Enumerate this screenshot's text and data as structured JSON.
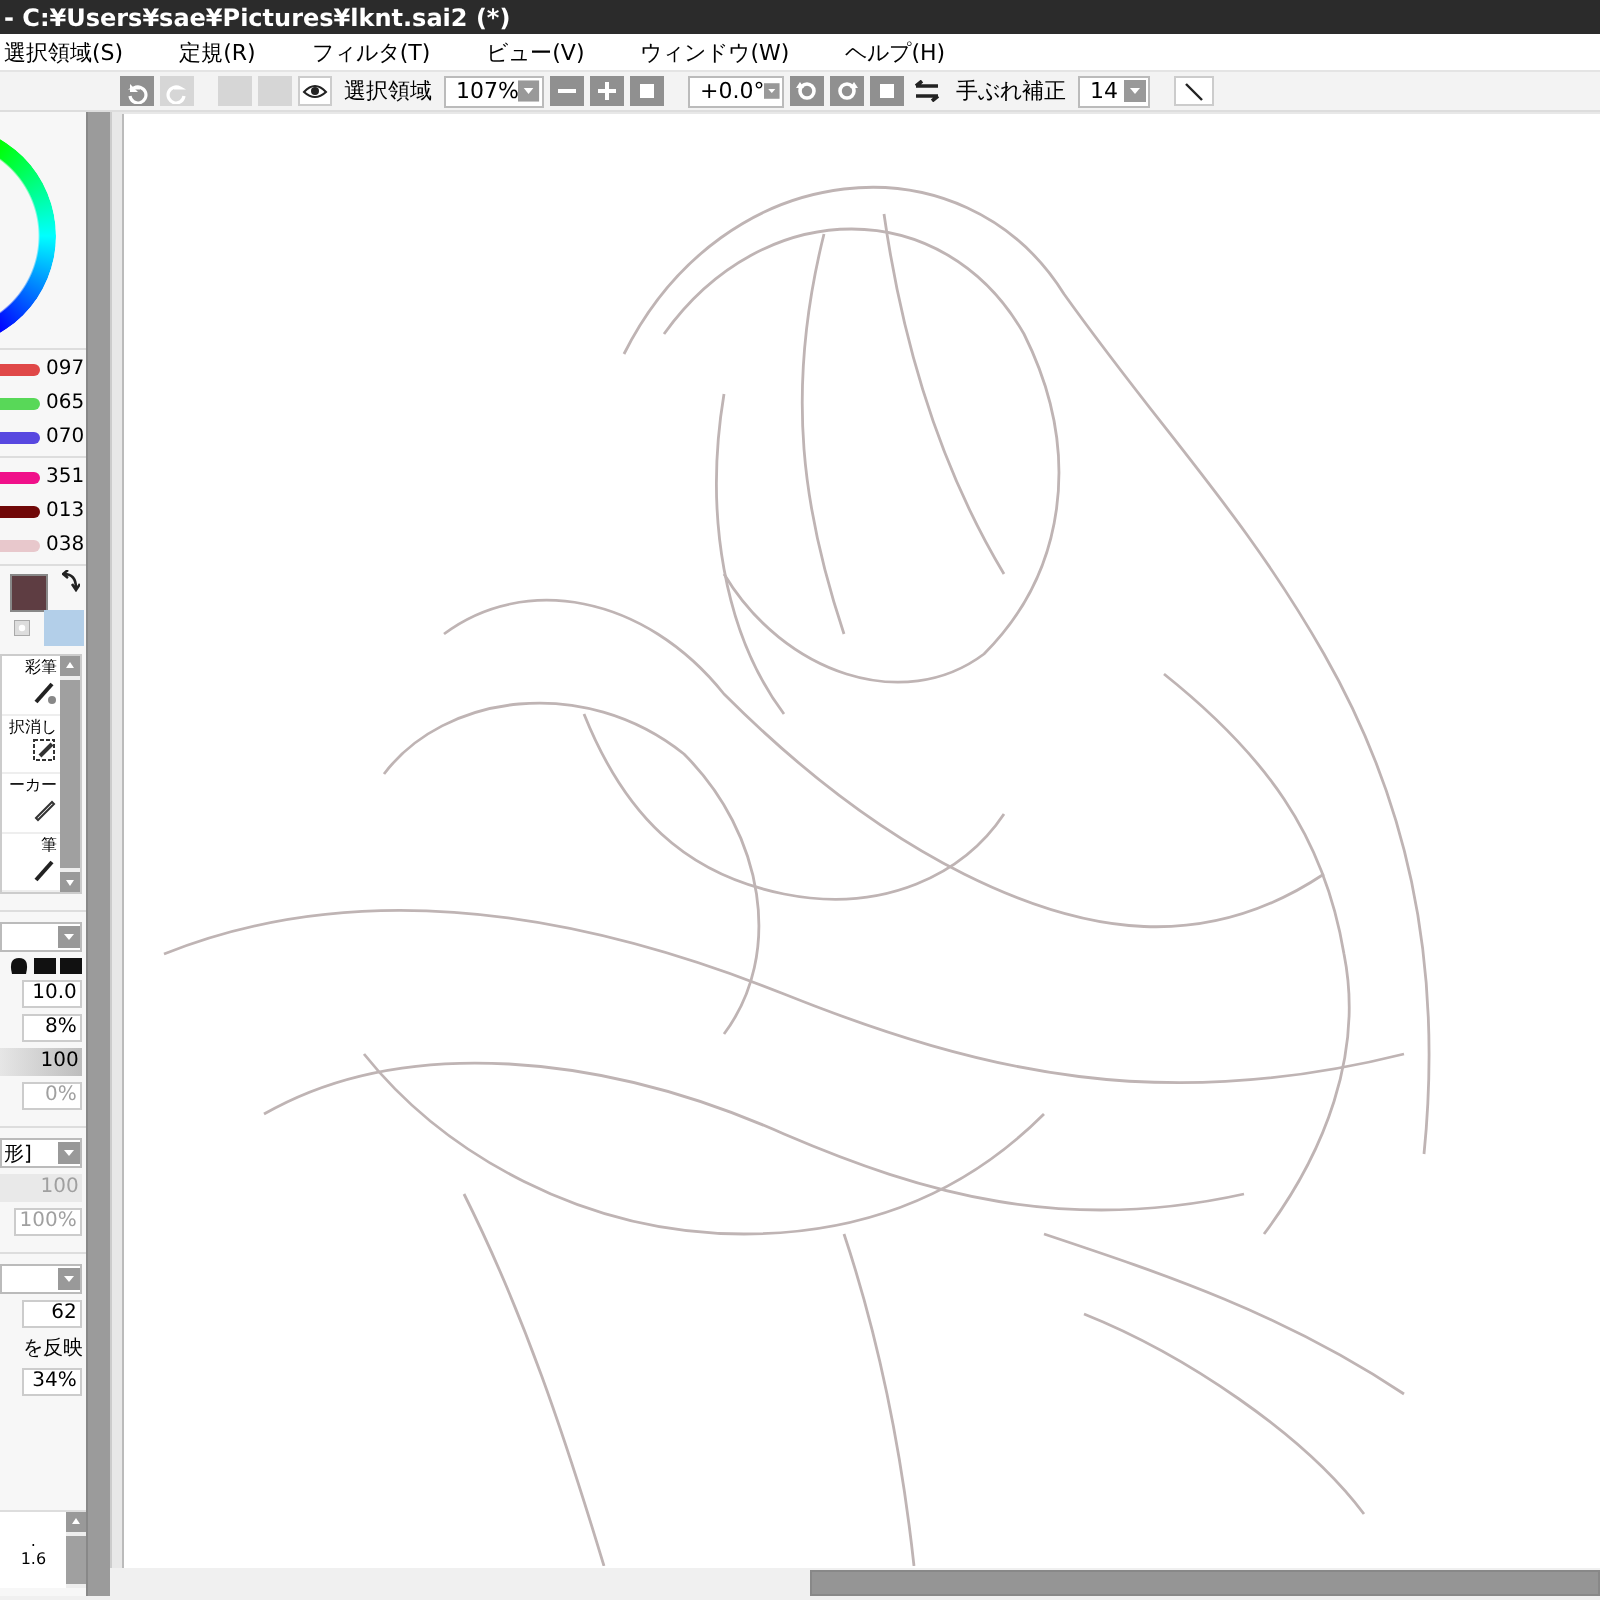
{
  "window": {
    "title": "- C:¥Users¥sae¥Pictures¥lknt.sai2 (*)"
  },
  "menu": [
    {
      "label": "選択領域(S)"
    },
    {
      "label": "定規(R)"
    },
    {
      "label": "フィルタ(T)"
    },
    {
      "label": "ビュー(V)"
    },
    {
      "label": "ウィンドウ(W)"
    },
    {
      "label": "ヘルプ(H)"
    }
  ],
  "toolbar": {
    "history": [
      {
        "kind": "undo",
        "disabled": false
      },
      {
        "kind": "redo",
        "disabled": true
      },
      {
        "kind": "blank",
        "disabled": true
      },
      {
        "kind": "blank",
        "disabled": true
      }
    ],
    "selection_label": "選択領域",
    "zoom": "107%",
    "angle": "+0.0°",
    "stabilizer_label": "手ぶれ補正",
    "stabilizer": "14"
  },
  "color_sliders": [
    [
      {
        "value": "097",
        "color": "#e04848"
      },
      {
        "value": "065",
        "color": "#58d858"
      },
      {
        "value": "070",
        "color": "#5848e0"
      }
    ],
    [
      {
        "value": "351",
        "color": "#f0108a"
      },
      {
        "value": "013",
        "color": "#700808"
      },
      {
        "value": "038",
        "color": "#e8c8cc"
      }
    ]
  ],
  "swatches": [
    {
      "color": "#5e3d42"
    },
    {
      "color": "#b3cfe9"
    }
  ],
  "tools": [
    {
      "label": "彩筆"
    },
    {
      "label": "択消し"
    },
    {
      "label": "ーカー"
    },
    {
      "label": "筆"
    }
  ],
  "settings": [
    [
      {
        "kind": "select"
      },
      {
        "kind": "shapes"
      },
      {
        "kind": "field",
        "value": "10.0",
        "disabled": false
      },
      {
        "kind": "field",
        "value": "8%",
        "disabled": false
      },
      {
        "kind": "slider",
        "value": "100",
        "disabled": false
      },
      {
        "kind": "field",
        "value": "0%",
        "disabled": true
      }
    ],
    [
      {
        "kind": "select",
        "value": "形]"
      },
      {
        "kind": "slider",
        "value": "100",
        "disabled": true
      },
      {
        "kind": "field",
        "value": "100%",
        "disabled": true
      }
    ],
    [
      {
        "kind": "select"
      },
      {
        "kind": "field",
        "value": "62",
        "disabled": false
      },
      {
        "kind": "label",
        "value": "を反映"
      },
      {
        "kind": "field",
        "value": "34%",
        "disabled": false
      }
    ]
  ],
  "size_list": {
    "marker": ".",
    "value": "1.6"
  }
}
